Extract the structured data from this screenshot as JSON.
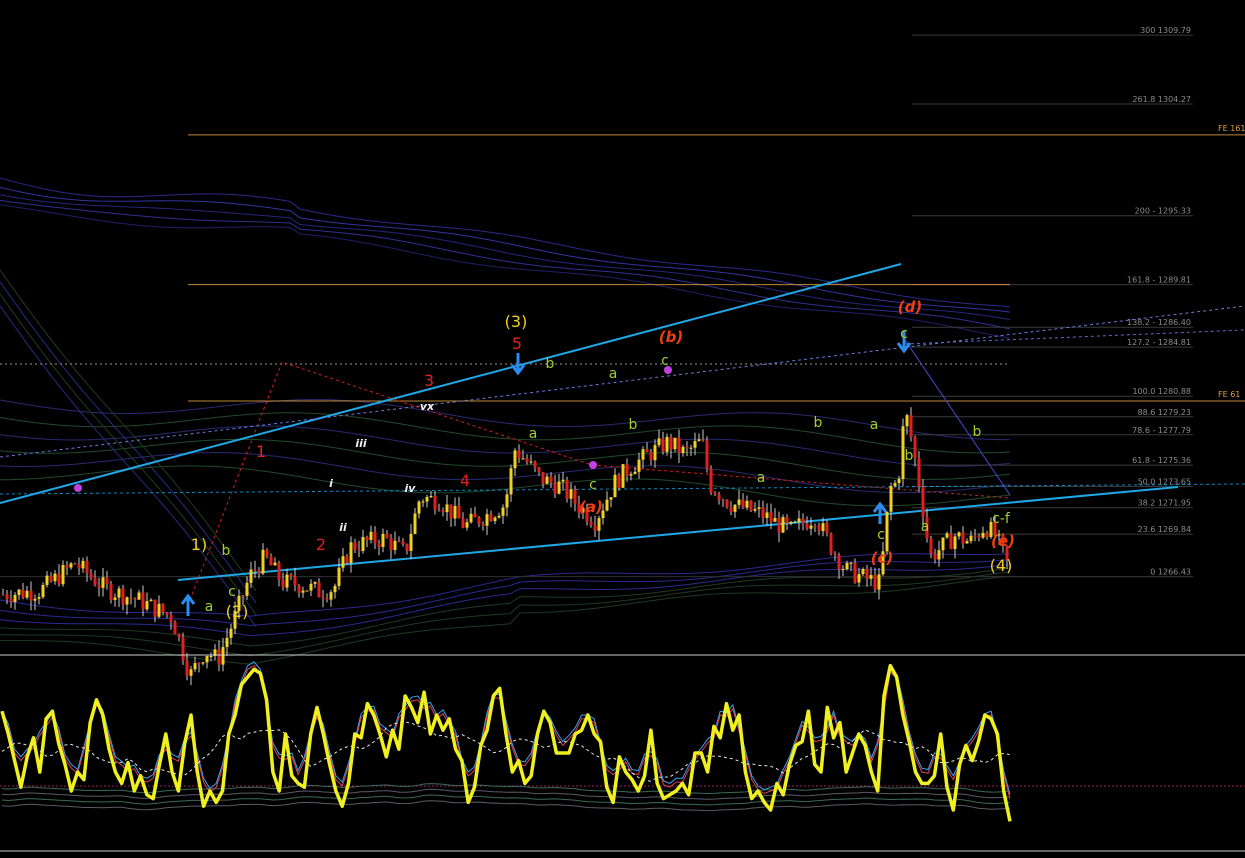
{
  "chart_data": [
    {
      "type": "candlestick",
      "title": "",
      "xlabel": "",
      "ylabel": "",
      "ylim": [
        1260.4,
        1312.6
      ],
      "fib_levels": [
        {
          "label": "300 1309.79",
          "price": 1309.79
        },
        {
          "label": "261.8 1304.27",
          "price": 1304.27
        },
        {
          "label": "200 - 1295.33",
          "price": 1295.33
        },
        {
          "label": "161.8 - 1289.81",
          "price": 1289.81
        },
        {
          "label": "138.2 - 1286.40",
          "price": 1286.4
        },
        {
          "label": "127.2 - 1284.81",
          "price": 1284.81
        },
        {
          "label": "100.0 1280.88",
          "price": 1280.88
        },
        {
          "label": "88.6 1279.23",
          "price": 1279.23
        },
        {
          "label": "78.6 - 1277.79",
          "price": 1277.79
        },
        {
          "label": "61.8 - 1275.36",
          "price": 1275.36
        },
        {
          "label": "50.0 1273.65",
          "price": 1273.65
        },
        {
          "label": "38.2 1271.95",
          "price": 1271.95
        },
        {
          "label": "23.6 1269.84",
          "price": 1269.84
        },
        {
          "label": "0 1266.43",
          "price": 1266.43
        }
      ],
      "fe_levels": [
        {
          "label": "FE 161",
          "price": 1301.8
        },
        {
          "label": "FE 61",
          "price": 1280.5
        }
      ],
      "price_path": [
        [
          0,
          1265.0
        ],
        [
          40,
          1265.3
        ],
        [
          75,
          1267.5
        ],
        [
          105,
          1265.5
        ],
        [
          140,
          1264.5
        ],
        [
          172,
          1263.2
        ],
        [
          190,
          1258.5
        ],
        [
          205,
          1260.5
        ],
        [
          218,
          1259.8
        ],
        [
          232,
          1262.6
        ],
        [
          250,
          1266.5
        ],
        [
          265,
          1268.0
        ],
        [
          282,
          1266.0
        ],
        [
          300,
          1265.8
        ],
        [
          320,
          1265.2
        ],
        [
          334,
          1265.5
        ],
        [
          350,
          1268.8
        ],
        [
          365,
          1269.2
        ],
        [
          385,
          1269.5
        ],
        [
          405,
          1268.3
        ],
        [
          420,
          1272.8
        ],
        [
          440,
          1272.5
        ],
        [
          465,
          1270.5
        ],
        [
          490,
          1271.5
        ],
        [
          505,
          1272.2
        ],
        [
          515,
          1276.6
        ],
        [
          525,
          1275.8
        ],
        [
          540,
          1274.3
        ],
        [
          560,
          1273.7
        ],
        [
          580,
          1272.0
        ],
        [
          595,
          1270.9
        ],
        [
          615,
          1274.0
        ],
        [
          630,
          1275.2
        ],
        [
          650,
          1276.3
        ],
        [
          668,
          1277.2
        ],
        [
          685,
          1276.3
        ],
        [
          702,
          1277.3
        ],
        [
          710,
          1273.8
        ],
        [
          730,
          1272.3
        ],
        [
          760,
          1271.5
        ],
        [
          790,
          1270.1
        ],
        [
          815,
          1271.3
        ],
        [
          830,
          1269.0
        ],
        [
          845,
          1267.0
        ],
        [
          865,
          1266.3
        ],
        [
          880,
          1265.9
        ],
        [
          890,
          1273.5
        ],
        [
          898,
          1274.0
        ],
        [
          905,
          1279.8
        ],
        [
          912,
          1277.2
        ],
        [
          920,
          1273.5
        ],
        [
          930,
          1268.0
        ],
        [
          945,
          1269.0
        ],
        [
          955,
          1269.7
        ],
        [
          970,
          1269.2
        ],
        [
          985,
          1270.5
        ],
        [
          995,
          1269.8
        ],
        [
          1012,
          1266.5
        ]
      ],
      "lines": [
        {
          "name": "",
          "color": "#1ea8e8"
        },
        {
          "name": "",
          "color": "#1ea8e8"
        },
        {
          "name": "",
          "color": "#6a7ad8"
        },
        {
          "name": "",
          "color": "#5a6ad0"
        },
        {
          "name": "",
          "color": "#d02020"
        }
      ],
      "wave_labels": [
        {
          "text": "(3)",
          "color": "#f0d020"
        },
        {
          "text": "5",
          "color": "#e02020"
        },
        {
          "text": "3",
          "color": "#e02020"
        },
        {
          "text": "4",
          "color": "#e02020"
        },
        {
          "text": "1",
          "color": "#e02020"
        },
        {
          "text": "2",
          "color": "#e02020"
        },
        {
          "text": "iii",
          "color": "#f0f0f0"
        },
        {
          "text": "vx",
          "color": "#f0f0f0"
        },
        {
          "text": "i",
          "color": "#f0f0f0"
        },
        {
          "text": "iv",
          "color": "#f0f0f0"
        },
        {
          "text": "ii",
          "color": "#f0f0f0"
        },
        {
          "text": "1)",
          "color": "#f0d020"
        },
        {
          "text": "b",
          "color": "#9fd030"
        },
        {
          "text": "a",
          "color": "#9fd030"
        },
        {
          "text": "c",
          "color": "#9fd030"
        },
        {
          "text": "(2)",
          "color": "#f0d020"
        },
        {
          "text": "b",
          "color": "#9fd030"
        },
        {
          "text": "a",
          "color": "#9fd030"
        },
        {
          "text": "c",
          "color": "#9fd030"
        },
        {
          "text": "(a)",
          "color": "#f04010"
        },
        {
          "text": "(b)",
          "color": "#f04010"
        },
        {
          "text": "c",
          "color": "#9fd030"
        },
        {
          "text": "a",
          "color": "#9fd030"
        },
        {
          "text": "b",
          "color": "#9fd030"
        },
        {
          "text": "b",
          "color": "#9fd030"
        },
        {
          "text": "a",
          "color": "#9fd030"
        },
        {
          "text": "c",
          "color": "#9fd030"
        },
        {
          "text": "(c)",
          "color": "#f04010"
        },
        {
          "text": "(d)",
          "color": "#f04010"
        },
        {
          "text": "c",
          "color": "#9fd030"
        },
        {
          "text": "a",
          "color": "#9fd030"
        },
        {
          "text": "b",
          "color": "#9fd030"
        },
        {
          "text": "b",
          "color": "#9fd030"
        },
        {
          "text": "a",
          "color": "#9fd030"
        },
        {
          "text": "c-f",
          "color": "#9fd030"
        },
        {
          "text": "(e)",
          "color": "#f04010"
        },
        {
          "text": "(4)",
          "color": "#f0d020"
        }
      ]
    },
    {
      "type": "line",
      "title": "",
      "ylim": [
        0,
        100
      ],
      "series": [
        {
          "color": "#f0f020",
          "values": [
            72,
            60,
            46,
            32,
            48,
            58,
            40,
            68,
            72,
            55,
            44,
            30,
            40,
            36,
            66,
            78,
            70,
            52,
            40,
            34,
            45,
            30,
            38,
            28,
            26,
            44,
            60,
            40,
            30,
            55,
            70,
            40,
            22,
            30,
            24,
            30,
            60,
            70,
            86,
            90,
            94,
            92,
            78,
            40,
            30,
            60,
            38,
            34,
            32,
            60,
            74,
            60,
            44,
            30,
            22,
            34,
            60,
            58,
            76,
            70,
            60,
            48,
            62,
            52,
            80,
            74,
            66,
            82,
            60,
            70,
            62,
            68,
            52,
            46,
            24,
            32,
            54,
            62,
            80,
            84,
            60,
            40,
            46,
            34,
            38,
            60,
            72,
            66,
            50,
            50,
            50,
            60,
            62,
            70,
            60,
            56,
            32,
            24,
            48,
            40,
            36,
            30,
            38,
            62,
            34,
            26,
            28,
            30,
            34,
            28,
            50,
            50,
            40,
            64,
            58,
            76,
            62,
            70,
            40,
            26,
            30,
            24,
            20,
            34,
            28,
            44,
            54,
            56,
            72,
            44,
            40,
            74,
            58,
            66,
            40,
            50,
            60,
            54,
            40,
            30,
            80,
            96,
            90,
            70,
            56,
            40,
            34,
            34,
            38,
            60,
            32,
            20,
            44,
            54,
            46,
            56,
            70,
            68,
            60,
            30,
            14
          ]
        },
        {
          "color": "#3ea0f0",
          "values": []
        },
        {
          "color": "#e04050",
          "values": []
        },
        {
          "color": "#e8e8e8",
          "values": []
        }
      ]
    }
  ]
}
